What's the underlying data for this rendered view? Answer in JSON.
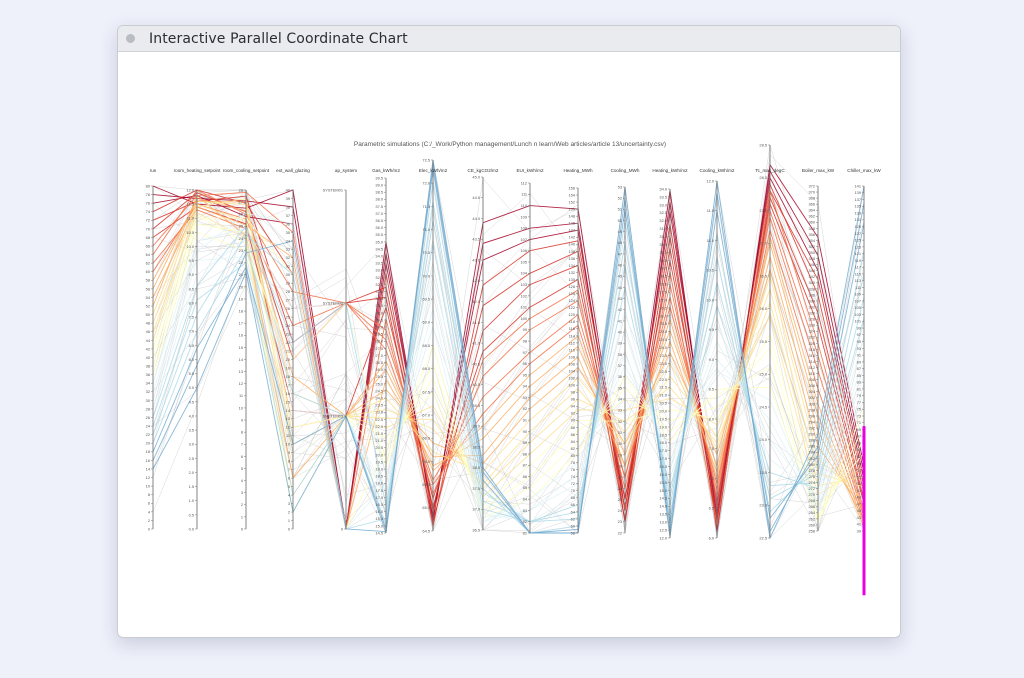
{
  "window": {
    "title": "Interactive Parallel Coordinate Chart"
  },
  "chart_data": {
    "type": "parallel_coordinates",
    "title": "Parametric simulations (C:/_Work/Python management/Lunch n learn/Web articles/article 13/uncertainty.csv)",
    "colorscale": [
      "#313695",
      "#4575b4",
      "#74add1",
      "#abd9e9",
      "#e0f3f8",
      "#ffffbf",
      "#fee090",
      "#fdae61",
      "#f46d43",
      "#d73027",
      "#a50026"
    ],
    "color_by": "run",
    "highlight_color": "#e600e6",
    "highlight_axis": "Chiller_max_kW",
    "highlight_range": [
      20,
      70
    ],
    "axes": [
      {
        "label": "run",
        "range": [
          0,
          80
        ],
        "ticks": [
          "80",
          "78",
          "76",
          "74",
          "72",
          "70",
          "68",
          "66",
          "64",
          "62",
          "60",
          "58",
          "56",
          "54",
          "52",
          "50",
          "48",
          "46",
          "44",
          "42",
          "40",
          "38",
          "36",
          "34",
          "32",
          "30",
          "28",
          "26",
          "24",
          "22",
          "20",
          "18",
          "16",
          "14",
          "12",
          "10",
          "8",
          "6",
          "4",
          "2",
          "0"
        ]
      },
      {
        "label": "room_heating_setpoint",
        "range": [
          0,
          12
        ],
        "ticks": [
          "12.0",
          "11.5",
          "11.0",
          "10.5",
          "10.0",
          "9.5",
          "9.0",
          "8.5",
          "8.0",
          "7.5",
          "7.0",
          "6.5",
          "6.0",
          "5.5",
          "5.0",
          "4.5",
          "4.0",
          "3.5",
          "3.0",
          "2.5",
          "2.0",
          "1.5",
          "1.0",
          "0.5",
          "0.0"
        ]
      },
      {
        "label": "room_cooling_setpoint",
        "range": [
          0,
          28
        ],
        "ticks": [
          "28",
          "27",
          "26",
          "25",
          "24",
          "23",
          "22",
          "21",
          "20",
          "19",
          "18",
          "17",
          "16",
          "15",
          "14",
          "13",
          "12",
          "11",
          "10",
          "9",
          "8",
          "7",
          "6",
          "5",
          "4",
          "3",
          "2",
          "1",
          "0"
        ]
      },
      {
        "label": "ext_wall_glazing",
        "range": [
          0,
          40
        ],
        "ticks": [
          "40",
          "39",
          "38",
          "37",
          "36",
          "35",
          "34",
          "33",
          "32",
          "31",
          "30",
          "29",
          "28",
          "27",
          "26",
          "25",
          "24",
          "23",
          "22",
          "21",
          "20",
          "19",
          "18",
          "17",
          "16",
          "15",
          "14",
          "13",
          "12",
          "11",
          "10",
          "9",
          "8",
          "7",
          "6",
          "5",
          "4",
          "3",
          "2",
          "1",
          "0"
        ]
      },
      {
        "label": "ap_system",
        "range": [
          0,
          3
        ],
        "ticks": [
          "SYSTEM01",
          "SYSTEM02",
          "SYSTEM03",
          "0"
        ]
      },
      {
        "label": "Gas_kWh/m2",
        "range": [
          14.5,
          39.5
        ],
        "ticks": [
          "39.5",
          "39.0",
          "38.5",
          "38.0",
          "37.5",
          "37.0",
          "36.5",
          "36.0",
          "35.5",
          "35.0",
          "34.5",
          "34.0",
          "33.5",
          "33.0",
          "32.5",
          "32.0",
          "31.5",
          "31.0",
          "30.5",
          "30.0",
          "29.5",
          "29.0",
          "28.5",
          "28.0",
          "27.5",
          "27.0",
          "26.5",
          "26.0",
          "25.5",
          "25.0",
          "24.5",
          "24.0",
          "23.5",
          "23.0",
          "22.5",
          "22.0",
          "21.5",
          "21.0",
          "20.5",
          "20.0",
          "19.5",
          "19.0",
          "18.5",
          "18.0",
          "17.5",
          "17.0",
          "16.5",
          "16.0",
          "15.5",
          "15.0",
          "14.5"
        ]
      },
      {
        "label": "Elec_kWh/m2",
        "range": [
          64.5,
          72.5
        ],
        "ticks": [
          "72.5",
          "72.0",
          "71.5",
          "71.0",
          "70.5",
          "70.0",
          "69.5",
          "69.0",
          "68.5",
          "68.0",
          "67.5",
          "67.0",
          "66.5",
          "66.0",
          "65.5",
          "65.0",
          "64.5"
        ]
      },
      {
        "label": "CE_kgCO2/m2",
        "range": [
          36.5,
          45
        ],
        "ticks": [
          "45.0",
          "44.5",
          "44.0",
          "43.5",
          "43.0",
          "42.5",
          "42.0",
          "41.5",
          "41.0",
          "40.5",
          "40.0",
          "39.5",
          "39.0",
          "38.5",
          "38.0",
          "37.5",
          "37.0",
          "36.5"
        ]
      },
      {
        "label": "EUI_kWh/m2",
        "range": [
          81,
          112
        ],
        "ticks": [
          "112",
          "111",
          "110",
          "109",
          "108",
          "107",
          "106",
          "105",
          "104",
          "103",
          "102",
          "101",
          "100",
          "99",
          "98",
          "97",
          "96",
          "95",
          "94",
          "93",
          "92",
          "91",
          "90",
          "89",
          "88",
          "87",
          "86",
          "85",
          "84",
          "83",
          "82",
          "81"
        ]
      },
      {
        "label": "Heating_MWh",
        "range": [
          58,
          156
        ],
        "ticks": [
          "156",
          "154",
          "152",
          "150",
          "148",
          "146",
          "144",
          "142",
          "140",
          "138",
          "136",
          "134",
          "132",
          "130",
          "128",
          "126",
          "124",
          "122",
          "120",
          "118",
          "116",
          "114",
          "112",
          "110",
          "108",
          "106",
          "104",
          "102",
          "100",
          "98",
          "96",
          "94",
          "92",
          "90",
          "88",
          "86",
          "84",
          "82",
          "80",
          "78",
          "76",
          "74",
          "72",
          "70",
          "68",
          "66",
          "64",
          "62",
          "60",
          "58"
        ]
      },
      {
        "label": "Cooling_MWh",
        "range": [
          22,
          53
        ],
        "ticks": [
          "53",
          "52",
          "51",
          "50",
          "49",
          "48",
          "47",
          "46",
          "45",
          "44",
          "43",
          "42",
          "41",
          "40",
          "39",
          "38",
          "37",
          "36",
          "35",
          "34",
          "33",
          "32",
          "31",
          "30",
          "29",
          "28",
          "27",
          "26",
          "25",
          "24",
          "23",
          "22"
        ]
      },
      {
        "label": "Heating_kWh/m2",
        "range": [
          12,
          34
        ],
        "ticks": [
          "34.0",
          "33.5",
          "33.0",
          "32.5",
          "32.0",
          "31.5",
          "31.0",
          "30.5",
          "30.0",
          "29.5",
          "29.0",
          "28.5",
          "28.0",
          "27.5",
          "27.0",
          "26.5",
          "26.0",
          "25.5",
          "25.0",
          "24.5",
          "24.0",
          "23.5",
          "23.0",
          "22.5",
          "22.0",
          "21.5",
          "21.0",
          "20.5",
          "20.0",
          "19.5",
          "19.0",
          "18.5",
          "18.0",
          "17.5",
          "17.0",
          "16.5",
          "16.0",
          "15.5",
          "15.0",
          "14.5",
          "14.0",
          "13.5",
          "13.0",
          "12.5",
          "12.0"
        ]
      },
      {
        "label": "Cooling_kWh/m2",
        "range": [
          6,
          12
        ],
        "ticks": [
          "12.0",
          "11.5",
          "11.0",
          "10.5",
          "10.0",
          "9.5",
          "9.0",
          "8.5",
          "8.0",
          "7.5",
          "7.0",
          "6.5",
          "6.0"
        ]
      },
      {
        "label": "Tc_max_degC",
        "range": [
          22.5,
          28.5
        ],
        "ticks": [
          "28.5",
          "28.0",
          "27.5",
          "27.0",
          "26.5",
          "26.0",
          "25.5",
          "25.0",
          "24.5",
          "24.0",
          "23.5",
          "23.0",
          "22.5"
        ]
      },
      {
        "label": "Boiler_max_kW",
        "range": [
          258,
          372
        ],
        "ticks": [
          "372",
          "370",
          "368",
          "366",
          "364",
          "362",
          "360",
          "358",
          "356",
          "354",
          "352",
          "350",
          "348",
          "346",
          "344",
          "342",
          "340",
          "338",
          "336",
          "334",
          "332",
          "330",
          "328",
          "326",
          "324",
          "322",
          "320",
          "318",
          "316",
          "314",
          "312",
          "310",
          "308",
          "306",
          "304",
          "302",
          "300",
          "298",
          "296",
          "294",
          "292",
          "290",
          "288",
          "286",
          "284",
          "282",
          "280",
          "278",
          "276",
          "274",
          "272",
          "270",
          "268",
          "266",
          "264",
          "262",
          "260",
          "258"
        ]
      },
      {
        "label": "Chiller_max_kW",
        "range": [
          39,
          141
        ],
        "ticks": [
          "141",
          "139",
          "137",
          "135",
          "133",
          "131",
          "129",
          "127",
          "125",
          "123",
          "121",
          "119",
          "117",
          "115",
          "113",
          "111",
          "109",
          "107",
          "105",
          "103",
          "101",
          "99",
          "97",
          "95",
          "93",
          "91",
          "89",
          "87",
          "85",
          "83",
          "81",
          "79",
          "77",
          "75",
          "73",
          "71",
          "69",
          "67",
          "65",
          "63",
          "61",
          "59",
          "57",
          "55",
          "53",
          "51",
          "49",
          "47",
          "45",
          "43",
          "41",
          "39"
        ]
      }
    ],
    "records": [
      [
        80,
        11.5,
        26.5,
        40,
        0,
        35.0,
        64.7,
        43.9,
        110,
        150,
        24,
        33.9,
        6.1,
        28.2,
        355,
        58
      ],
      [
        78,
        11.7,
        27.1,
        38,
        0,
        34.2,
        64.8,
        43.4,
        108,
        146,
        23,
        33.2,
        6.3,
        28.1,
        349,
        56
      ],
      [
        76,
        11.8,
        25.8,
        36,
        0,
        33.5,
        64.9,
        43.0,
        107,
        144,
        24,
        32.6,
        6.4,
        28.0,
        344,
        54
      ],
      [
        74,
        12.0,
        26.9,
        30,
        0,
        32.8,
        64.6,
        42.4,
        106,
        141,
        25,
        31.8,
        6.2,
        27.8,
        341,
        52
      ],
      [
        72,
        11.6,
        27.5,
        22,
        2,
        31.8,
        65.0,
        41.9,
        104,
        138,
        24,
        31.0,
        6.5,
        27.9,
        336,
        50
      ],
      [
        70,
        11.9,
        26.2,
        20,
        2,
        31.1,
        64.7,
        41.3,
        103,
        134,
        23,
        30.3,
        6.3,
        27.7,
        330,
        48
      ],
      [
        68,
        11.4,
        25.2,
        14,
        1,
        30.4,
        65.2,
        40.8,
        101,
        130,
        25,
        29.5,
        6.6,
        27.6,
        326,
        47
      ],
      [
        66,
        11.8,
        27.8,
        35,
        0,
        29.6,
        64.9,
        40.6,
        100,
        127,
        24,
        28.8,
        6.2,
        27.8,
        320,
        45
      ],
      [
        64,
        12.0,
        26.0,
        28,
        2,
        28.8,
        65.3,
        40.2,
        99,
        124,
        26,
        28.0,
        6.7,
        27.5,
        316,
        44
      ],
      [
        62,
        11.3,
        24.8,
        26,
        2,
        28.1,
        65.6,
        39.7,
        97,
        120,
        27,
        27.2,
        6.8,
        27.4,
        311,
        43
      ],
      [
        60,
        11.5,
        25.6,
        24,
        2,
        27.4,
        65.5,
        39.3,
        96,
        117,
        27,
        26.6,
        6.9,
        27.2,
        305,
        42
      ],
      [
        58,
        11.6,
        27.0,
        12,
        1,
        26.6,
        65.8,
        39.0,
        95,
        114,
        28,
        25.8,
        7.0,
        27.1,
        300,
        41
      ],
      [
        56,
        11.7,
        26.3,
        18,
        1,
        26.0,
        65.9,
        38.7,
        94,
        111,
        29,
        25.1,
        7.2,
        27.0,
        296,
        40
      ],
      [
        54,
        11.4,
        25.1,
        32,
        0,
        25.3,
        66.1,
        38.3,
        93,
        108,
        28,
        24.4,
        7.1,
        26.8,
        291,
        42
      ],
      [
        52,
        11.8,
        24.2,
        6,
        1,
        24.6,
        66.4,
        38.1,
        92,
        105,
        30,
        23.7,
        7.4,
        26.6,
        286,
        45
      ],
      [
        50,
        11.6,
        26.8,
        10,
        1,
        24.0,
        66.2,
        37.9,
        91,
        102,
        31,
        23.0,
        7.5,
        26.5,
        282,
        48
      ],
      [
        48,
        11.5,
        25.4,
        16,
        1,
        23.2,
        66.7,
        37.6,
        90,
        99,
        30,
        22.2,
        7.7,
        26.3,
        277,
        52
      ],
      [
        46,
        11.2,
        24.0,
        4,
        1,
        22.6,
        66.9,
        37.5,
        89,
        96,
        32,
        21.5,
        7.6,
        26.1,
        273,
        55
      ],
      [
        44,
        11.4,
        27.3,
        8,
        1,
        21.9,
        67.2,
        37.3,
        88,
        93,
        33,
        20.8,
        7.9,
        25.9,
        270,
        58
      ],
      [
        42,
        11.1,
        23.6,
        2,
        1,
        21.2,
        67.5,
        37.1,
        87,
        90,
        32,
        20.1,
        8.0,
        25.6,
        266,
        62
      ],
      [
        40,
        11.0,
        25.7,
        30,
        0,
        20.5,
        67.8,
        37.0,
        86,
        87,
        34,
        19.4,
        8.2,
        25.4,
        263,
        66
      ],
      [
        38,
        10.8,
        24.5,
        12,
        1,
        19.8,
        68.1,
        36.9,
        85,
        84,
        35,
        18.7,
        8.4,
        25.1,
        261,
        70
      ],
      [
        36,
        10.5,
        23.0,
        20,
        2,
        19.2,
        68.5,
        36.8,
        84,
        81,
        36,
        18.1,
        8.5,
        24.8,
        262,
        75
      ],
      [
        34,
        10.2,
        24.8,
        26,
        2,
        18.6,
        68.9,
        36.7,
        84,
        78,
        37,
        17.5,
        8.8,
        24.6,
        264,
        80
      ],
      [
        32,
        9.8,
        26.1,
        36,
        0,
        18.0,
        69.3,
        36.7,
        83,
        75,
        38,
        16.9,
        9.0,
        24.3,
        266,
        85
      ],
      [
        30,
        9.5,
        22.5,
        8,
        1,
        17.4,
        69.8,
        36.8,
        83,
        72,
        40,
        16.3,
        9.3,
        24.0,
        268,
        90
      ],
      [
        28,
        9.0,
        23.9,
        14,
        1,
        16.9,
        70.2,
        36.9,
        82,
        69,
        42,
        15.7,
        9.6,
        23.7,
        270,
        96
      ],
      [
        26,
        8.6,
        25.0,
        22,
        2,
        16.4,
        70.7,
        37.0,
        82,
        66,
        44,
        15.1,
        9.9,
        23.5,
        272,
        102
      ],
      [
        24,
        8.1,
        22.0,
        4,
        1,
        15.9,
        71.2,
        37.2,
        82,
        64,
        46,
        14.6,
        10.3,
        23.3,
        274,
        108
      ],
      [
        22,
        7.6,
        24.3,
        30,
        0,
        15.5,
        71.6,
        37.4,
        82,
        62,
        48,
        14.0,
        10.7,
        23.1,
        277,
        115
      ],
      [
        20,
        7.0,
        23.2,
        16,
        1,
        15.1,
        72.0,
        37.5,
        81,
        60,
        50,
        13.4,
        11.1,
        22.9,
        280,
        122
      ],
      [
        18,
        6.4,
        21.6,
        10,
        1,
        14.8,
        72.3,
        37.7,
        81,
        59,
        51,
        12.9,
        11.5,
        22.8,
        283,
        130
      ],
      [
        16,
        5.8,
        22.8,
        34,
        0,
        14.6,
        72.4,
        37.9,
        81,
        58,
        52,
        12.4,
        11.8,
        22.6,
        286,
        136
      ],
      [
        14,
        5.0,
        21.2,
        2,
        1,
        14.5,
        72.5,
        38.0,
        81,
        58,
        53,
        12.1,
        12.0,
        22.5,
        290,
        141
      ]
    ]
  }
}
